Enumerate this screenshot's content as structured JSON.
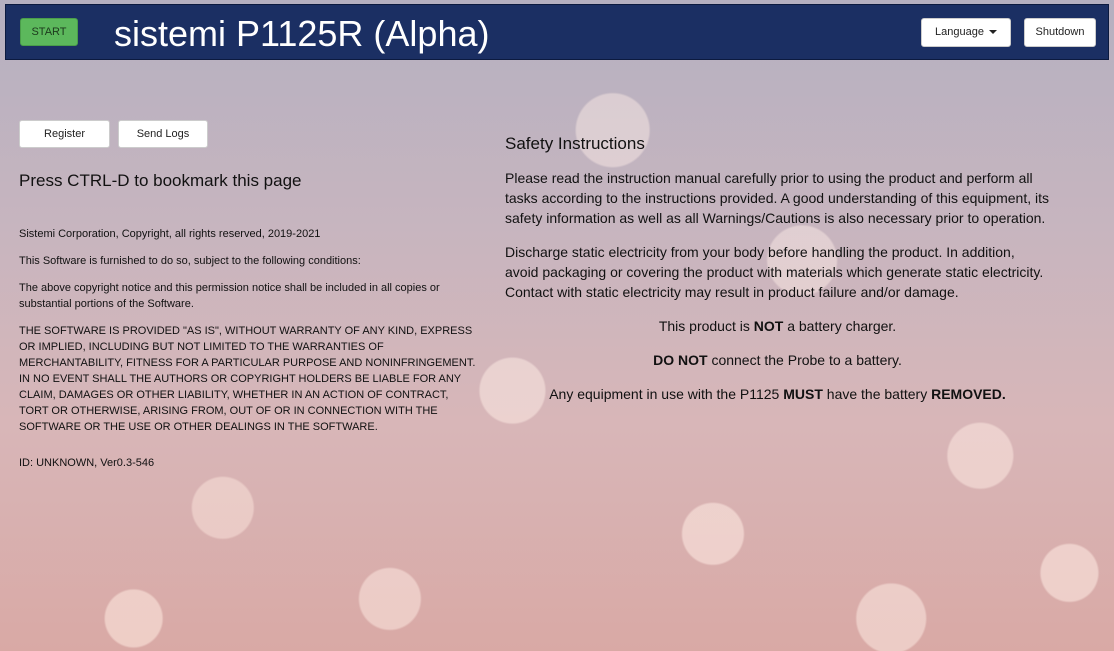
{
  "navbar": {
    "start_label": "START",
    "title": "sistemi P1125R (Alpha)",
    "language_label": "Language",
    "shutdown_label": "Shutdown"
  },
  "actions": {
    "register_label": "Register",
    "send_logs_label": "Send Logs"
  },
  "bookmark_hint": "Press CTRL-D to bookmark this page",
  "license": {
    "copyright": "Sistemi Corporation, Copyright, all rights reserved, 2019-2021",
    "furnished": "This Software is furnished to do so, subject to the following conditions:",
    "notice": "The above copyright notice and this permission notice shall be included in all copies or substantial portions of the Software.",
    "disclaimer": "THE SOFTWARE IS PROVIDED \"AS IS\", WITHOUT WARRANTY OF ANY KIND, EXPRESS OR IMPLIED, INCLUDING BUT NOT LIMITED TO THE WARRANTIES OF MERCHANTABILITY, FITNESS FOR A PARTICULAR PURPOSE AND NONINFRINGEMENT. IN NO EVENT SHALL THE AUTHORS OR COPYRIGHT HOLDERS BE LIABLE FOR ANY CLAIM, DAMAGES OR OTHER LIABILITY, WHETHER IN AN ACTION OF CONTRACT, TORT OR OTHERWISE, ARISING FROM, OUT OF OR IN CONNECTION WITH THE SOFTWARE OR THE USE OR OTHER DEALINGS IN THE SOFTWARE.",
    "id_version": "ID: UNKNOWN, Ver0.3-546"
  },
  "safety": {
    "title": "Safety Instructions",
    "para1": "Please read the instruction manual carefully prior to using the product and perform all tasks according to the instructions provided. A good understanding of this equipment, its safety information as well as all Warnings/Cautions is also necessary prior to operation.",
    "para2": "Discharge static electricity from your body before handling the product. In addition, avoid packaging or covering the product with materials which generate static electricity. Contact with static electricity may result in product failure and/or damage.",
    "charger_pre": "This product is ",
    "charger_bold": "NOT",
    "charger_post": " a battery charger.",
    "probe_bold": "DO NOT",
    "probe_post": " connect the Probe to a battery.",
    "equip_pre": "Any equipment in use with the P1125 ",
    "equip_bold1": "MUST",
    "equip_mid": " have the battery ",
    "equip_bold2": "REMOVED."
  }
}
